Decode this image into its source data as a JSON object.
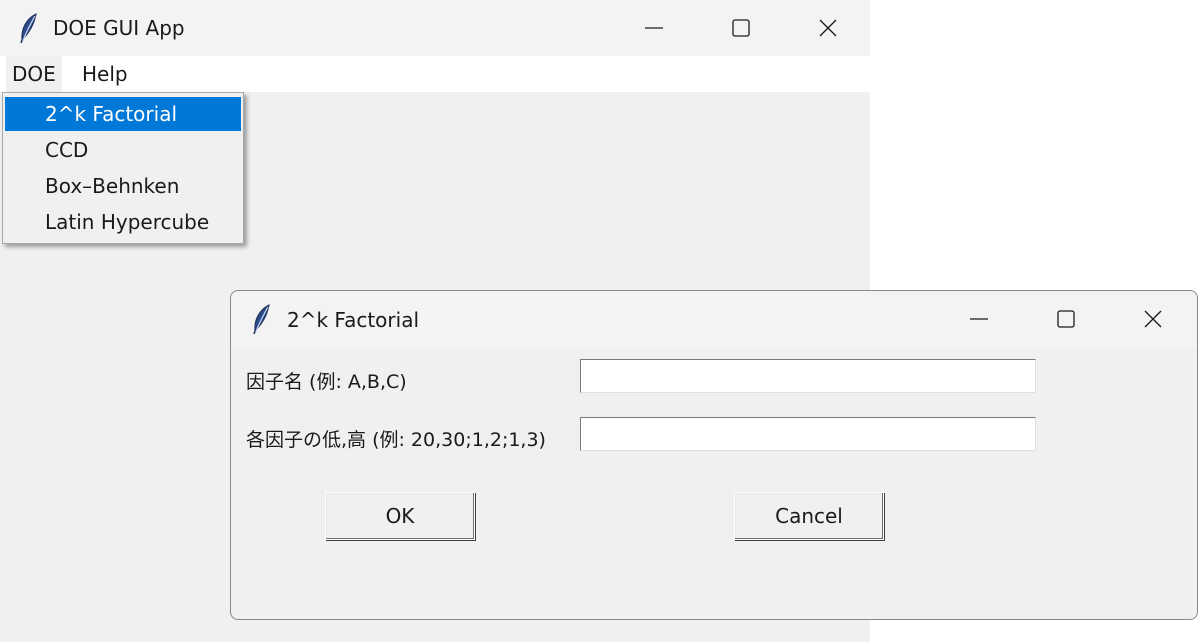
{
  "main_window": {
    "title": "DOE GUI App",
    "menubar": [
      "DOE",
      "Help"
    ],
    "doe_menu": {
      "items": [
        "2^k Factorial",
        "CCD",
        "Box–Behnken",
        "Latin Hypercube"
      ],
      "selected": "2^k Factorial"
    }
  },
  "dialog": {
    "title": "2^k Factorial",
    "fields": [
      {
        "label": "因子名 (例: A,B,C)",
        "value": ""
      },
      {
        "label": "各因子の低,高 (例: 20,30;1,2;1,3)",
        "value": ""
      }
    ],
    "ok_label": "OK",
    "cancel_label": "Cancel"
  },
  "colors": {
    "selection": "#0078d7",
    "window_bg": "#f0f0f0",
    "titlebar_bg": "#f3f3f3"
  },
  "icons": {
    "app": "feather-icon",
    "minimize": "minimize-icon",
    "maximize": "maximize-icon",
    "close": "close-icon"
  }
}
